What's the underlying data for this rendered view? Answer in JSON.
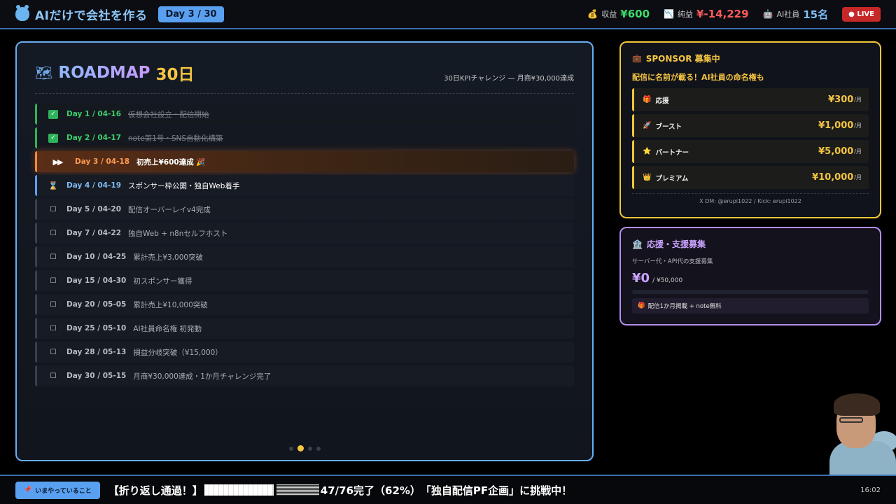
{
  "header": {
    "app_title": "AIだけで会社を作る",
    "day_badge": "Day 3 / 30",
    "stats": [
      {
        "icon": "money-bag-icon",
        "label": "収益",
        "value": "¥600"
      },
      {
        "icon": "chart-icon",
        "label": "純益",
        "value": "¥-14,229"
      },
      {
        "icon": "robot-icon",
        "label": "AI社員",
        "value": "15名"
      }
    ],
    "live_label": "● LIVE"
  },
  "roadmap": {
    "title": "ROADMAP",
    "title_days": "30日",
    "subtitle": "30日KPIチャレンジ — 月商¥30,000達成",
    "items": [
      {
        "status": "done",
        "day": "Day 1 / 04-16",
        "text": "仮想会社設立・配信開始"
      },
      {
        "status": "done",
        "day": "Day 2 / 04-17",
        "text": "note第1号・SNS自動化構築"
      },
      {
        "status": "current",
        "day": "Day 3 / 04-18",
        "text": "初売上¥600達成 🎉"
      },
      {
        "status": "next",
        "day": "Day 4 / 04-19",
        "text": "スポンサー枠公開・独自Web着手"
      },
      {
        "status": "todo",
        "day": "Day 5 / 04-20",
        "text": "配信オーバーレイv4完成"
      },
      {
        "status": "todo",
        "day": "Day 7 / 04-22",
        "text": "独自Web + n8nセルフホスト"
      },
      {
        "status": "todo",
        "day": "Day 10 / 04-25",
        "text": "累計売上¥3,000突破"
      },
      {
        "status": "todo",
        "day": "Day 15 / 04-30",
        "text": "初スポンサー獲得"
      },
      {
        "status": "todo",
        "day": "Day 20 / 05-05",
        "text": "累計売上¥10,000突破"
      },
      {
        "status": "todo",
        "day": "Day 25 / 05-10",
        "text": "AI社員命名権 初発動"
      },
      {
        "status": "todo",
        "day": "Day 28 / 05-13",
        "text": "損益分岐突破（¥15,000）"
      },
      {
        "status": "todo",
        "day": "Day 30 / 05-15",
        "text": "月商¥30,000達成・1か月チャレンジ完了"
      }
    ],
    "page_dots": 4,
    "active_dot": 1
  },
  "sponsor": {
    "title": "SPONSOR 募集中",
    "tagline": "配信に名前が載る！AI社員の命名権も",
    "tiers": [
      {
        "icon": "gift-icon",
        "name": "応援",
        "price": "¥300",
        "unit": "/月"
      },
      {
        "icon": "rocket-icon",
        "name": "ブースト",
        "price": "¥1,000",
        "unit": "/月"
      },
      {
        "icon": "star-icon",
        "name": "パートナー",
        "price": "¥5,000",
        "unit": "/月"
      },
      {
        "icon": "crown-icon",
        "name": "プレミアム",
        "price": "¥10,000",
        "unit": "/月"
      }
    ],
    "contact": "X DM: @erupi1022 / Kick: erupi1022"
  },
  "support": {
    "title": "応援・支援募集",
    "subtitle": "サーバー代・API代の支援募集",
    "current": "¥0",
    "goal": "/ ¥50,000",
    "progress": 0,
    "perk": "配信1か月掲載 + note無料"
  },
  "footer": {
    "now_label": "いまやっていること",
    "ticker_prefix": "【折り返し通過！】",
    "ticker_suffix": "47/76完了（62%）　「独自配信PF企画」に挑戦中！",
    "progress_percent": 62,
    "clock": "16:02"
  },
  "colors": {
    "accent_blue": "#5aa0f0",
    "done_green": "#2fb35a",
    "current_orange": "#ff8a3a",
    "sponsor_gold": "#f0c93a",
    "support_purple": "#b48ff0",
    "live_red": "#c62828"
  }
}
